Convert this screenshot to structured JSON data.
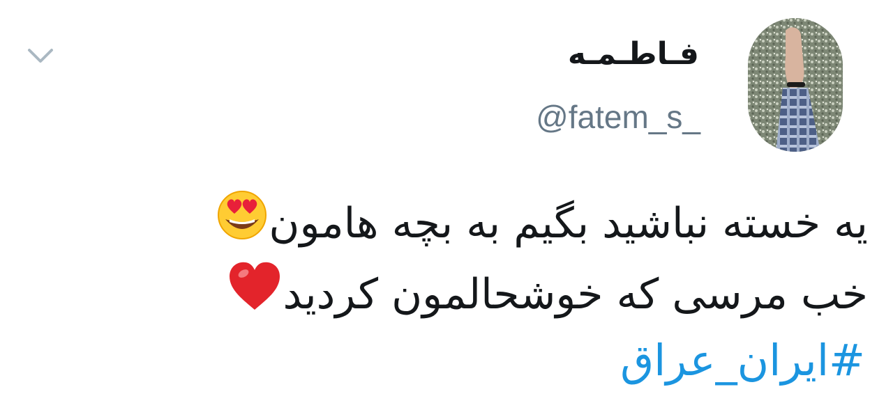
{
  "tweet": {
    "display_name": "فـاطـمـه",
    "handle": "@fatem_s_",
    "text_line1": "یه خسته نباشید بگیم به بچه هامون",
    "text_line2": "خب مرسی که خوشحالمون کردید",
    "hashtag": "#ایران_عراق",
    "emoji_line1": "heart-eyes-emoji",
    "emoji_line2": "red-heart-emoji"
  },
  "icons": {
    "menu": "chevron-down-icon"
  },
  "colors": {
    "text": "#14171a",
    "handle": "#657786",
    "hashtag": "#1b95e0",
    "caret": "#aab8c2"
  }
}
